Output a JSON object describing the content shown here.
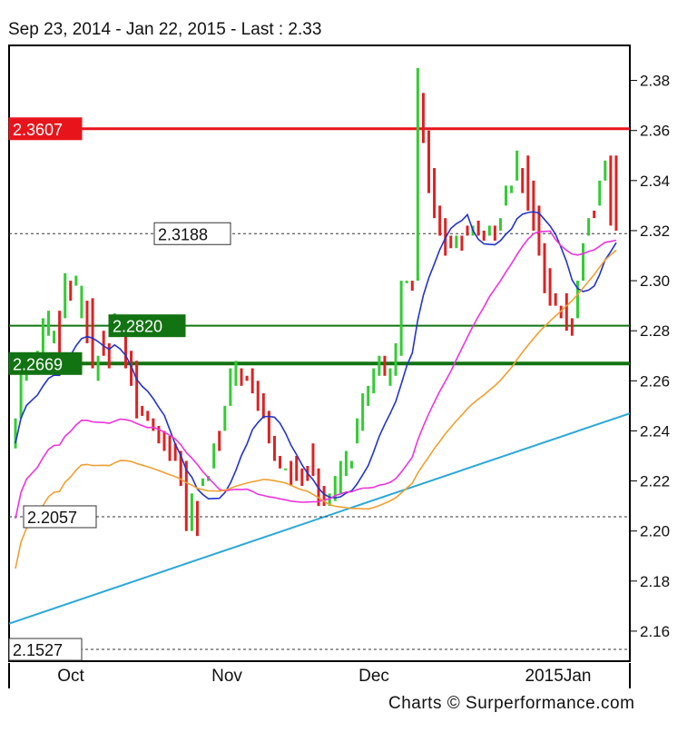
{
  "header": {
    "title": "Sep 23, 2014 - Jan 22, 2015 - Last : 2.33"
  },
  "footer": {
    "credit": "Charts © Surperformance.com"
  },
  "chart_data": {
    "type": "candlestick",
    "ylim": [
      2.148,
      2.394
    ],
    "y_ticks": [
      "2.16",
      "2.18",
      "2.20",
      "2.22",
      "2.24",
      "2.26",
      "2.28",
      "2.30",
      "2.32",
      "2.34",
      "2.36",
      "2.38"
    ],
    "x_ticks": [
      "Oct",
      "Nov",
      "Dec",
      "2015Jan"
    ],
    "levels": [
      {
        "label": "2.3607",
        "value": 2.3607,
        "color": "#e8141b",
        "style": "solid"
      },
      {
        "label": "2.3188",
        "value": 2.3188,
        "color": "#333333",
        "style": "dashed"
      },
      {
        "label": "2.2820",
        "value": 2.282,
        "color": "#127312",
        "style": "solid"
      },
      {
        "label": "2.2669",
        "value": 2.2669,
        "color": "#127312",
        "style": "solid-thick"
      },
      {
        "label": "2.2057",
        "value": 2.2057,
        "color": "#333333",
        "style": "dashed"
      },
      {
        "label": "2.1527",
        "value": 2.1527,
        "color": "#333333",
        "style": "dashed"
      }
    ],
    "candles": [
      [
        2.233,
        2.245
      ],
      [
        2.245,
        2.265
      ],
      [
        2.26,
        2.27
      ],
      [
        2.263,
        2.268
      ],
      [
        2.265,
        2.272
      ],
      [
        2.27,
        2.285
      ],
      [
        2.278,
        2.288
      ],
      [
        2.275,
        2.28
      ],
      [
        2.288,
        2.27
      ],
      [
        2.285,
        2.303
      ],
      [
        2.3,
        2.292
      ],
      [
        2.298,
        2.302
      ],
      [
        2.285,
        2.298
      ],
      [
        2.292,
        2.275
      ],
      [
        2.293,
        2.265
      ],
      [
        2.26,
        2.27
      ],
      [
        2.28,
        2.27
      ],
      [
        2.275,
        2.265
      ],
      [
        2.285,
        2.287
      ],
      [
        2.284,
        2.286
      ],
      [
        2.28,
        2.265
      ],
      [
        2.272,
        2.258
      ],
      [
        2.268,
        2.245
      ],
      [
        2.25,
        2.246
      ],
      [
        2.248,
        2.244
      ],
      [
        2.245,
        2.24
      ],
      [
        2.242,
        2.235
      ],
      [
        2.24,
        2.232
      ],
      [
        2.238,
        2.228
      ],
      [
        2.235,
        2.228
      ],
      [
        2.232,
        2.218
      ],
      [
        2.228,
        2.2
      ],
      [
        2.2,
        2.215
      ],
      [
        2.212,
        2.198
      ],
      [
        2.218,
        2.221
      ],
      [
        2.22,
        2.222
      ],
      [
        2.225,
        2.235
      ],
      [
        2.24,
        2.232
      ],
      [
        2.24,
        2.25
      ],
      [
        2.25,
        2.265
      ],
      [
        2.258,
        2.268
      ],
      [
        2.265,
        2.258
      ],
      [
        2.262,
        2.26
      ],
      [
        2.265,
        2.255
      ],
      [
        2.26,
        2.248
      ],
      [
        2.255,
        2.245
      ],
      [
        2.248,
        2.235
      ],
      [
        2.238,
        2.228
      ],
      [
        2.23,
        2.225
      ],
      [
        2.225,
        2.225
      ],
      [
        2.228,
        2.218
      ],
      [
        2.23,
        2.22
      ],
      [
        2.225,
        2.218
      ],
      [
        2.226,
        2.22
      ],
      [
        2.235,
        2.222
      ],
      [
        2.225,
        2.21
      ],
      [
        2.218,
        2.21
      ],
      [
        2.21,
        2.215
      ],
      [
        2.212,
        2.222
      ],
      [
        2.215,
        2.228
      ],
      [
        2.222,
        2.232
      ],
      [
        2.225,
        2.228
      ],
      [
        2.235,
        2.245
      ],
      [
        2.24,
        2.255
      ],
      [
        2.25,
        2.258
      ],
      [
        2.255,
        2.265
      ],
      [
        2.262,
        2.27
      ],
      [
        2.27,
        2.262
      ],
      [
        2.258,
        2.265
      ],
      [
        2.262,
        2.275
      ],
      [
        2.27,
        2.3
      ],
      [
        2.299,
        2.3
      ],
      [
        2.3,
        2.296
      ],
      [
        2.3,
        2.385
      ],
      [
        2.375,
        2.355
      ],
      [
        2.36,
        2.335
      ],
      [
        2.345,
        2.325
      ],
      [
        2.33,
        2.318
      ],
      [
        2.325,
        2.31
      ],
      [
        2.318,
        2.313
      ],
      [
        2.313,
        2.318
      ],
      [
        2.318,
        2.312
      ],
      [
        2.322,
        2.318
      ],
      [
        2.318,
        2.322
      ],
      [
        2.324,
        2.318
      ],
      [
        2.32,
        2.316
      ],
      [
        2.318,
        2.322
      ],
      [
        2.322,
        2.316
      ],
      [
        2.32,
        2.325
      ],
      [
        2.33,
        2.338
      ],
      [
        2.335,
        2.338
      ],
      [
        2.34,
        2.352
      ],
      [
        2.345,
        2.335
      ],
      [
        2.35,
        2.328
      ],
      [
        2.34,
        2.32
      ],
      [
        2.33,
        2.31
      ],
      [
        2.315,
        2.295
      ],
      [
        2.305,
        2.29
      ],
      [
        2.295,
        2.29
      ],
      [
        2.29,
        2.285
      ],
      [
        2.295,
        2.28
      ],
      [
        2.285,
        2.278
      ],
      [
        2.285,
        2.3
      ],
      [
        2.3,
        2.315
      ],
      [
        2.318,
        2.325
      ],
      [
        2.328,
        2.325
      ],
      [
        2.33,
        2.34
      ],
      [
        2.34,
        2.348
      ],
      [
        2.35,
        2.322
      ],
      [
        2.35,
        2.32
      ]
    ],
    "support_line": {
      "from": [
        0,
        2.163
      ],
      "to": [
        1,
        2.247
      ],
      "color": "#2aa8d8"
    }
  }
}
